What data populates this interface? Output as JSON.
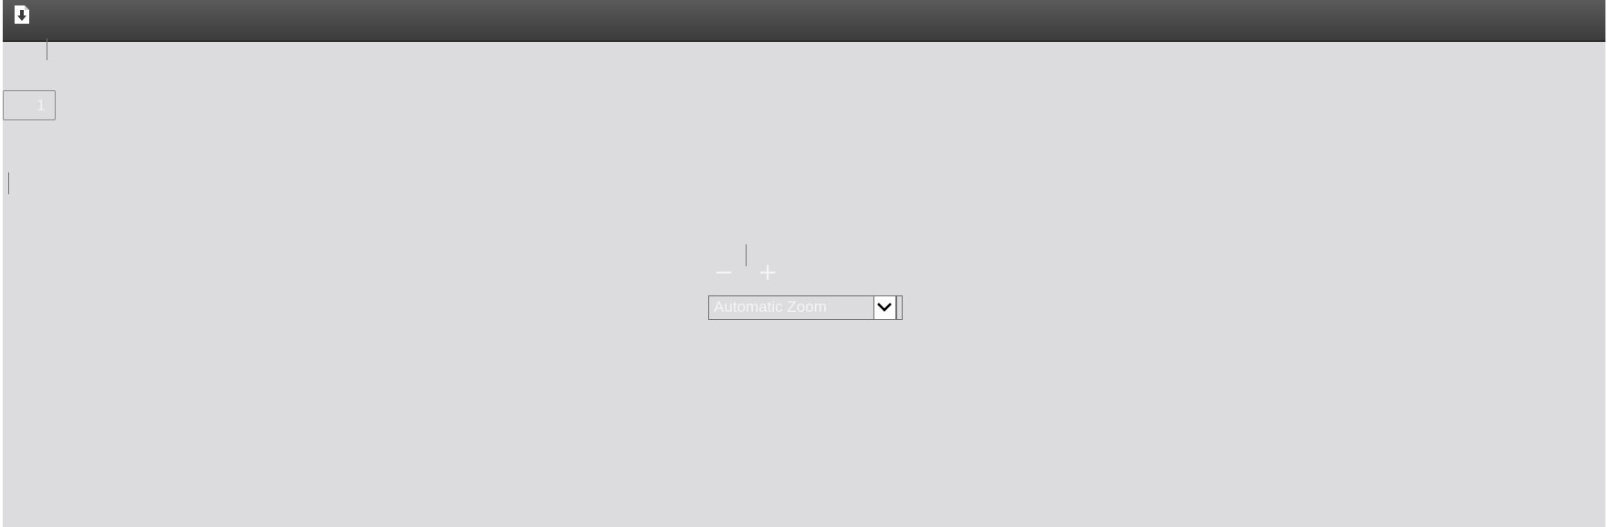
{
  "toolbar": {
    "download_icon": "download-icon"
  },
  "pagination": {
    "page_number": "1"
  },
  "zoom": {
    "zoom_out_label": "−",
    "zoom_in_label": "+",
    "selected_option": "Automatic Zoom",
    "dropdown_icon": "chevron-down-icon"
  },
  "colors": {
    "toolbar_bg": "#3f3f3f",
    "viewer_bg": "#dcdcde",
    "control_text": "#f4f4f4"
  }
}
